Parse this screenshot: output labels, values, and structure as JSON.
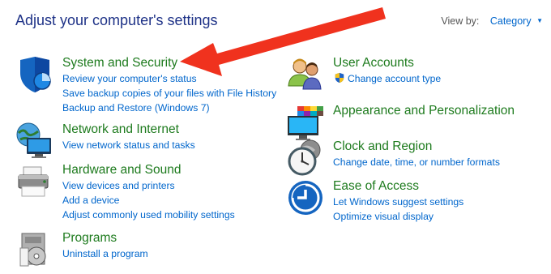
{
  "header": {
    "title": "Adjust your computer's settings",
    "view_by_label": "View by:",
    "view_by_value": "Category"
  },
  "categories": [
    {
      "heading": "System and Security",
      "icon": "shield-icon",
      "links": [
        "Review your computer's status",
        "Save backup copies of your files with File History",
        "Backup and Restore (Windows 7)"
      ]
    },
    {
      "heading": "Network and Internet",
      "icon": "network-globe-icon",
      "links": [
        "View network status and tasks"
      ]
    },
    {
      "heading": "Hardware and Sound",
      "icon": "printer-icon",
      "links": [
        "View devices and printers",
        "Add a device",
        "Adjust commonly used mobility settings"
      ]
    },
    {
      "heading": "Programs",
      "icon": "programs-disc-icon",
      "links": [
        "Uninstall a program"
      ]
    },
    {
      "heading": "User Accounts",
      "icon": "users-icon",
      "links": [
        "Change account type"
      ]
    },
    {
      "heading": "Appearance and Personalization",
      "icon": "monitor-palette-icon",
      "links": []
    },
    {
      "heading": "Clock and Region",
      "icon": "clock-globe-icon",
      "links": [
        "Change date, time, or number formats"
      ]
    },
    {
      "heading": "Ease of Access",
      "icon": "ease-of-access-icon",
      "links": [
        "Let Windows suggest settings",
        "Optimize visual display"
      ]
    }
  ],
  "colors": {
    "heading": "#1e7b1e",
    "link": "#0066cc",
    "title": "#1e3287",
    "annotation_arrow": "#f0321e"
  }
}
